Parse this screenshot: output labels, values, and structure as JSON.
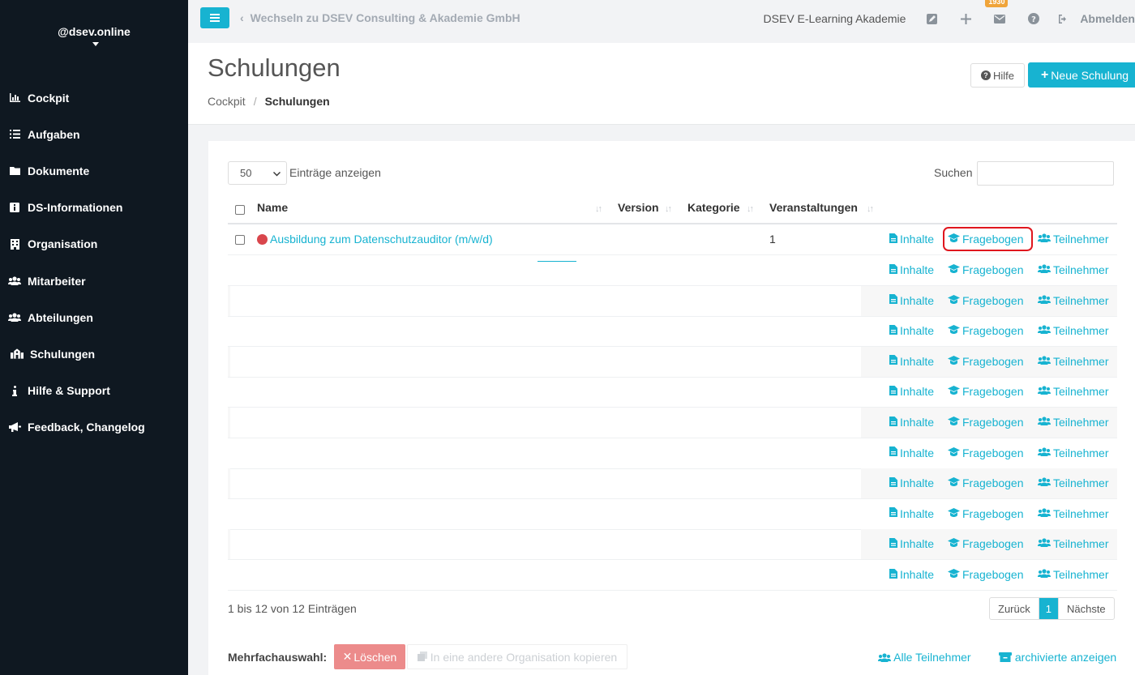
{
  "sidebar": {
    "user": "@dsev.online",
    "items": [
      {
        "label": "Cockpit",
        "icon": "chart-bar-icon"
      },
      {
        "label": "Aufgaben",
        "icon": "list-icon"
      },
      {
        "label": "Dokumente",
        "icon": "folder-icon"
      },
      {
        "label": "DS-Informationen",
        "icon": "info-square-icon"
      },
      {
        "label": "Organisation",
        "icon": "building-icon"
      },
      {
        "label": "Mitarbeiter",
        "icon": "users-icon"
      },
      {
        "label": "Abteilungen",
        "icon": "users-icon"
      },
      {
        "label": "Schulungen",
        "icon": "school-icon"
      },
      {
        "label": "Hilfe & Support",
        "icon": "info-icon"
      },
      {
        "label": "Feedback, Changelog",
        "icon": "bullhorn-icon"
      }
    ]
  },
  "topbar": {
    "switch_org": "Wechseln zu DSEV Consulting & Akademie GmbH",
    "academy": "DSEV E-Learning Akademie",
    "mail_badge": "1930",
    "logout": "Abmelden"
  },
  "header": {
    "title": "Schulungen",
    "breadcrumb": [
      "Cockpit",
      "Schulungen"
    ],
    "help_button": "Hilfe",
    "new_button": "Neue Schulung"
  },
  "table_controls": {
    "page_length": "50",
    "length_label": "Einträge anzeigen",
    "search_label": "Suchen"
  },
  "table": {
    "columns": [
      "Name",
      "Version",
      "Kategorie",
      "Veranstaltungen"
    ],
    "actions": {
      "inhalte": "Inhalte",
      "fragebogen": "Fragebogen",
      "teilnehmer": "Teilnehmer"
    },
    "rows": [
      {
        "name": "Ausbildung zum Datenschutzauditor (m/w/d)",
        "version": "",
        "kategorie": "",
        "veranstaltungen": "1",
        "status_color": "#d9464c"
      },
      {
        "name": "",
        "version": "",
        "kategorie": "",
        "veranstaltungen": ""
      },
      {
        "name": "",
        "version": "",
        "kategorie": "",
        "veranstaltungen": ""
      },
      {
        "name": "",
        "version": "",
        "kategorie": "",
        "veranstaltungen": ""
      },
      {
        "name": "",
        "version": "",
        "kategorie": "",
        "veranstaltungen": ""
      },
      {
        "name": "",
        "version": "",
        "kategorie": "",
        "veranstaltungen": ""
      },
      {
        "name": "",
        "version": "",
        "kategorie": "",
        "veranstaltungen": ""
      },
      {
        "name": "",
        "version": "",
        "kategorie": "",
        "veranstaltungen": ""
      },
      {
        "name": "",
        "version": "",
        "kategorie": "",
        "veranstaltungen": ""
      },
      {
        "name": "",
        "version": "",
        "kategorie": "",
        "veranstaltungen": ""
      },
      {
        "name": "",
        "version": "",
        "kategorie": "",
        "veranstaltungen": ""
      },
      {
        "name": "",
        "version": "",
        "kategorie": "",
        "veranstaltungen": ""
      }
    ]
  },
  "footer": {
    "info": "1 bis 12 von 12 Einträgen",
    "pager": {
      "prev": "Zurück",
      "current": "1",
      "next": "Nächste"
    },
    "multi_label": "Mehrfachauswahl:",
    "delete": "Löschen",
    "copy": "In eine andere Organisation kopieren",
    "all_participants": "Alle Teilnehmer",
    "archived": "archivierte anzeigen"
  },
  "colors": {
    "accent": "#17b3d1",
    "sidebar": "#0f1821",
    "danger": "#ec8b8b",
    "badge": "#f0a43a"
  }
}
